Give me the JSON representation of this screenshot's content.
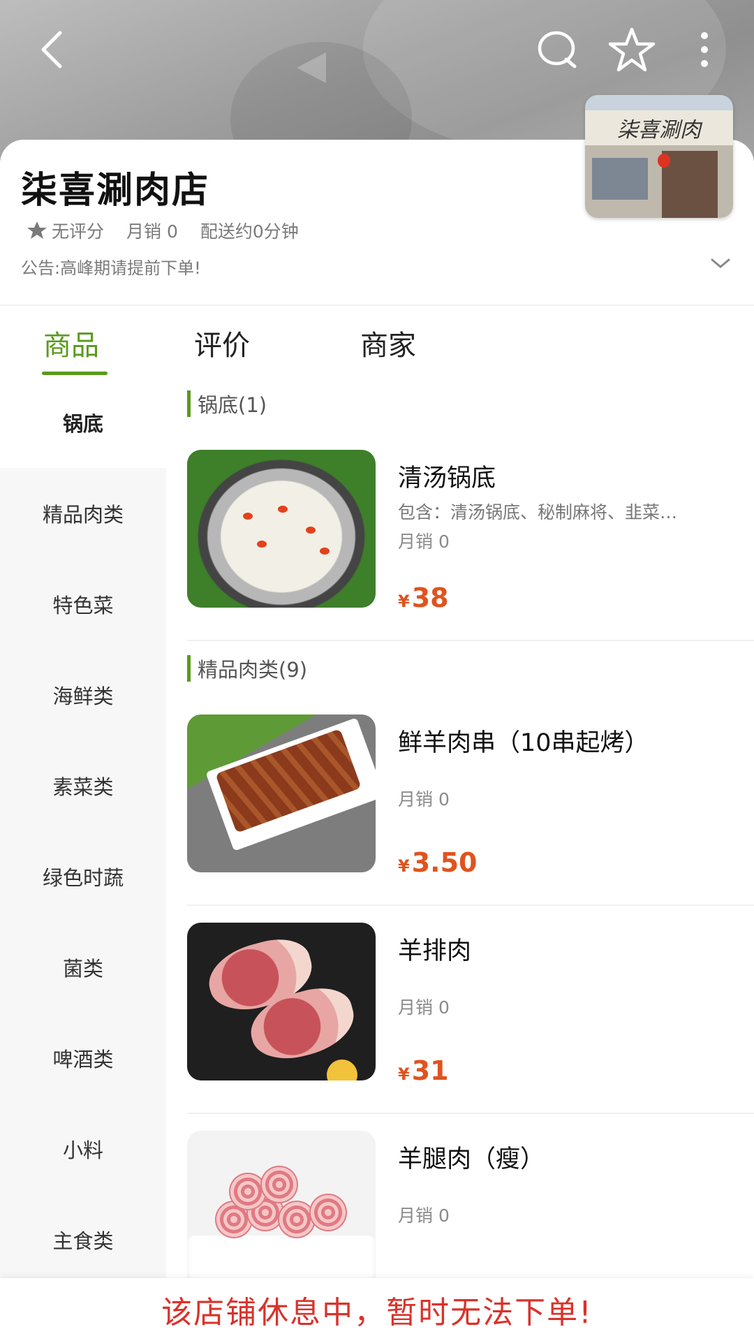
{
  "header": {
    "back_icon": "back-arrow-icon",
    "search_icon": "search-icon",
    "favorite_icon": "star-outline-icon",
    "more_icon": "more-vertical-icon"
  },
  "shop": {
    "name": "柒喜涮肉店",
    "rating": "无评分",
    "monthly_sales": "月销 0",
    "delivery": "配送约0分钟",
    "notice": "公告:高峰期请提前下单!",
    "photo_sign": "柒喜涮肉"
  },
  "tabs": [
    {
      "label": "商品",
      "active": true
    },
    {
      "label": "评价",
      "active": false
    },
    {
      "label": "商家",
      "active": false
    }
  ],
  "sidebar": {
    "items": [
      {
        "label": "锅底",
        "active": true
      },
      {
        "label": "精品肉类"
      },
      {
        "label": "特色菜"
      },
      {
        "label": "海鲜类"
      },
      {
        "label": "素菜类"
      },
      {
        "label": "绿色时蔬"
      },
      {
        "label": "菌类"
      },
      {
        "label": "啤酒类"
      },
      {
        "label": "小料"
      },
      {
        "label": "主食类"
      }
    ]
  },
  "sections": [
    {
      "title": "锅底(1)",
      "items": [
        {
          "name": "清汤锅底",
          "desc": "包含：清汤锅底、秘制麻将、韭菜…",
          "sales": "月销 0",
          "currency": "¥",
          "price": "38"
        }
      ]
    },
    {
      "title": "精品肉类(9)",
      "items": [
        {
          "name": "鲜羊肉串（10串起烤）",
          "desc": "",
          "sales": "月销 0",
          "currency": "¥",
          "price": "3.50"
        },
        {
          "name": "羊排肉",
          "desc": "",
          "sales": "月销 0",
          "currency": "¥",
          "price": "31"
        },
        {
          "name": "羊腿肉（瘦）",
          "desc": "",
          "sales": "月销 0",
          "currency": "¥",
          "price": ""
        }
      ]
    }
  ],
  "closed_message": "该店铺休息中，暂时无法下单!",
  "colors": {
    "accent": "#5a9a1e",
    "price": "#e0531e",
    "warning": "#d9332b"
  }
}
